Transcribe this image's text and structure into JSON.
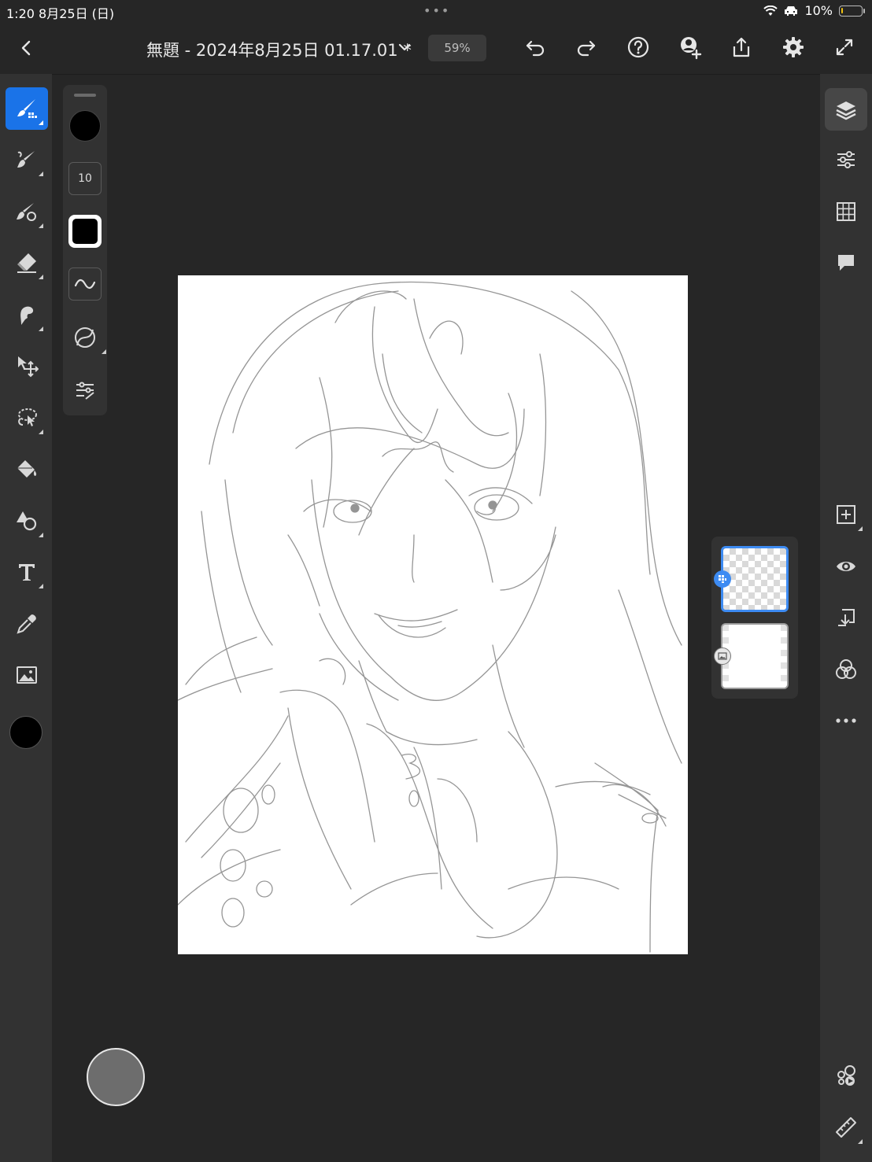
{
  "status_bar": {
    "time": "1:20",
    "date": "8月25日 (日)",
    "dots": "•••",
    "battery_percent": "10%",
    "battery_level": 0.1,
    "icons": [
      "wifi-icon",
      "car-icon",
      "battery-icon"
    ]
  },
  "top_bar": {
    "back_icon": "chevron-left-icon",
    "document_title": "無題 - 2024年8月25日 01.17.01 *",
    "title_menu_icon": "chevron-down-icon",
    "zoom_label": "59%",
    "actions": [
      "undo-icon",
      "redo-icon",
      "help-icon",
      "invite-icon",
      "share-icon",
      "settings-icon",
      "fullscreen-icon"
    ]
  },
  "left_tools": [
    {
      "name": "pixel-brush",
      "icon": "pixel-brush-icon",
      "active": true
    },
    {
      "name": "live-brush",
      "icon": "live-brush-icon"
    },
    {
      "name": "vector-brush",
      "icon": "vector-brush-icon"
    },
    {
      "name": "eraser",
      "icon": "eraser-icon"
    },
    {
      "name": "smudge",
      "icon": "smudge-icon"
    },
    {
      "name": "transform",
      "icon": "move-icon"
    },
    {
      "name": "lasso-select",
      "icon": "lasso-icon"
    },
    {
      "name": "fill",
      "icon": "paint-bucket-icon"
    },
    {
      "name": "shape",
      "icon": "shape-icon"
    },
    {
      "name": "text",
      "icon": "text-icon"
    },
    {
      "name": "eyedropper",
      "icon": "eyedropper-icon"
    },
    {
      "name": "image",
      "icon": "image-icon"
    }
  ],
  "current_color": "#000000",
  "brush_panel": {
    "color": "#000000",
    "size": "10",
    "items": [
      "brush-color-swatch",
      "brush-size-field",
      "brush-tip-shape",
      "smoothing-icon",
      "pressure-curve-icon",
      "brush-settings-icon"
    ]
  },
  "right_tools": {
    "top": [
      {
        "name": "layers",
        "icon": "layers-icon",
        "active": true
      },
      {
        "name": "adjustments",
        "icon": "sliders-icon"
      },
      {
        "name": "grid",
        "icon": "grid-icon"
      },
      {
        "name": "comments",
        "icon": "comment-icon"
      }
    ],
    "middle": [
      {
        "name": "add-layer",
        "icon": "add-layer-icon"
      },
      {
        "name": "visibility",
        "icon": "eye-icon"
      },
      {
        "name": "merge-layer",
        "icon": "merge-down-icon"
      },
      {
        "name": "blend-mode",
        "icon": "blend-mode-icon"
      },
      {
        "name": "more",
        "icon": "more-icon"
      }
    ],
    "bottom": [
      {
        "name": "timelapse",
        "icon": "timelapse-icon"
      },
      {
        "name": "ruler",
        "icon": "ruler-icon"
      }
    ]
  },
  "layers": [
    {
      "name": "sketch-layer",
      "selected": true,
      "type": "pixel"
    },
    {
      "name": "background-layer",
      "selected": false,
      "type": "image"
    }
  ],
  "colors": {
    "accent": "#1a73e8",
    "layer_selected": "#3d8bf2",
    "battery": "#f1c40f",
    "floating_button": "#6d6d6d"
  }
}
